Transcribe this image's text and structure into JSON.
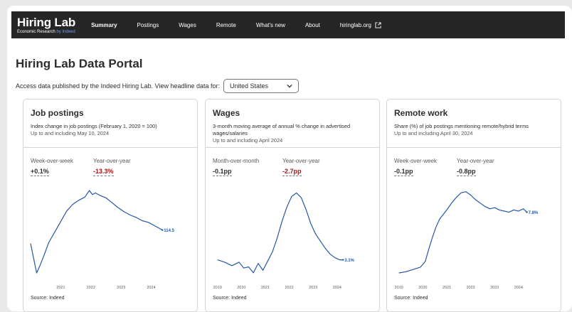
{
  "header": {
    "logo_title": "Hiring Lab",
    "logo_sub_prefix": "Economic Research ",
    "logo_sub_brand": "by Indeed",
    "nav": [
      "Summary",
      "Postings",
      "Wages",
      "Remote",
      "What's new",
      "About",
      "hiringlab.org"
    ]
  },
  "page": {
    "title": "Hiring Lab Data Portal",
    "intro": "Access data published by the Indeed Hiring Lab. View headline data for:",
    "country": "United States"
  },
  "cards": [
    {
      "title": "Job postings",
      "desc": "Index change in job postings (February 1, 2020 = 100)",
      "date": "Up to and including May 10, 2024",
      "m1_label": "Week-over-week",
      "m1_value": "+0.1%",
      "m2_label": "Year-over-year",
      "m2_value": "-13.3%",
      "end_label": "114.5",
      "source": "Source: Indeed"
    },
    {
      "title": "Wages",
      "desc": "3-month moving average of annual % change in advertised wages/salaries",
      "date": "Up to and including April 2024",
      "m1_label": "Month-over-month",
      "m1_value": "-0.1pp",
      "m2_label": "Year-over-year",
      "m2_value": "-2.7pp",
      "end_label": "3.1%",
      "source": "Source: Indeed"
    },
    {
      "title": "Remote work",
      "desc": "Share (%) of job postings mentioning remote/hybrid terms",
      "date": "Up to and including April 30, 2024",
      "m1_label": "Week-over-week",
      "m1_value": "-0.1pp",
      "m2_label": "Year-over-year",
      "m2_value": "-0.8pp",
      "end_label": "7.8%",
      "source": "Source: Indeed"
    }
  ],
  "chart_data": [
    {
      "type": "line",
      "x_ticks": [
        "2021",
        "2022",
        "2023",
        "2024"
      ],
      "x": [
        2020.0,
        2020.1,
        2020.2,
        2020.3,
        2020.45,
        2020.6,
        2020.8,
        2021.0,
        2021.2,
        2021.4,
        2021.6,
        2021.8,
        2021.95,
        2022.05,
        2022.15,
        2022.3,
        2022.5,
        2022.7,
        2022.9,
        2023.1,
        2023.3,
        2023.5,
        2023.7,
        2023.9,
        2024.1,
        2024.3,
        2024.37
      ],
      "y": [
        98,
        80,
        62,
        70,
        84,
        99,
        112,
        125,
        138,
        146,
        151,
        155,
        163,
        158,
        160,
        157,
        154,
        148,
        142,
        137,
        133,
        130,
        126,
        124,
        120,
        116,
        114.5
      ],
      "ylim": [
        55,
        170
      ],
      "color": "#2557a7"
    },
    {
      "type": "line",
      "x_ticks": [
        "2019",
        "2020",
        "2021",
        "2022",
        "2023",
        "2024"
      ],
      "x": [
        2019.0,
        2019.3,
        2019.6,
        2019.9,
        2020.1,
        2020.3,
        2020.5,
        2020.7,
        2020.9,
        2021.1,
        2021.3,
        2021.5,
        2021.7,
        2021.9,
        2022.1,
        2022.3,
        2022.5,
        2022.7,
        2022.9,
        2023.1,
        2023.3,
        2023.5,
        2023.7,
        2023.9,
        2024.1,
        2024.25
      ],
      "y": [
        3.1,
        2.9,
        2.6,
        2.9,
        2.4,
        2.5,
        2.0,
        2.8,
        2.2,
        3.0,
        3.8,
        5.0,
        6.4,
        7.6,
        8.5,
        8.8,
        8.4,
        7.4,
        6.2,
        5.3,
        4.7,
        4.1,
        3.6,
        3.3,
        3.1,
        3.1
      ],
      "ylim": [
        1.5,
        9.5
      ],
      "color": "#2557a7"
    },
    {
      "type": "line",
      "x_ticks": [
        "2019",
        "2020",
        "2021",
        "2022",
        "2023",
        "2024"
      ],
      "x": [
        2019.0,
        2019.3,
        2019.6,
        2019.9,
        2020.1,
        2020.25,
        2020.4,
        2020.55,
        2020.7,
        2020.85,
        2021.0,
        2021.2,
        2021.4,
        2021.6,
        2021.8,
        2022.0,
        2022.2,
        2022.4,
        2022.6,
        2022.8,
        2023.0,
        2023.2,
        2023.4,
        2023.6,
        2023.8,
        2024.0,
        2024.2,
        2024.35
      ],
      "y": [
        2.5,
        2.6,
        2.8,
        3.0,
        3.5,
        4.6,
        5.6,
        6.5,
        7.2,
        7.6,
        8.0,
        8.6,
        9.1,
        9.5,
        9.6,
        9.3,
        8.9,
        8.6,
        8.3,
        8.1,
        8.2,
        8.0,
        7.9,
        7.8,
        8.0,
        7.9,
        8.1,
        7.8
      ],
      "ylim": [
        2.0,
        10.2
      ],
      "color": "#2557a7"
    }
  ]
}
